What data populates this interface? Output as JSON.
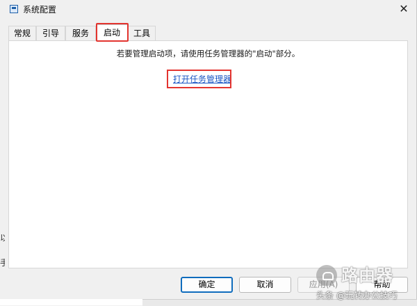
{
  "window": {
    "title": "系统配置",
    "close_glyph": "✕"
  },
  "tabs": [
    {
      "label": "常规",
      "active": false
    },
    {
      "label": "引导",
      "active": false
    },
    {
      "label": "服务",
      "active": false
    },
    {
      "label": "启动",
      "active": true
    },
    {
      "label": "工具",
      "active": false
    }
  ],
  "startup": {
    "info_text": "若要管理启动项，请使用任务管理器的\"启动\"部分。",
    "link_text": "打开任务管理器"
  },
  "buttons": {
    "ok": "确定",
    "cancel": "取消",
    "apply": "应用(A)",
    "help": "帮助"
  },
  "background_fragments": [
    "以",
    "手"
  ],
  "watermark": {
    "brand": "路由器",
    "credit": "头条 @玩转办公技巧"
  },
  "colors": {
    "highlight_box": "#e3342f",
    "link": "#1a56c4",
    "primary_border": "#0f6cbd"
  }
}
